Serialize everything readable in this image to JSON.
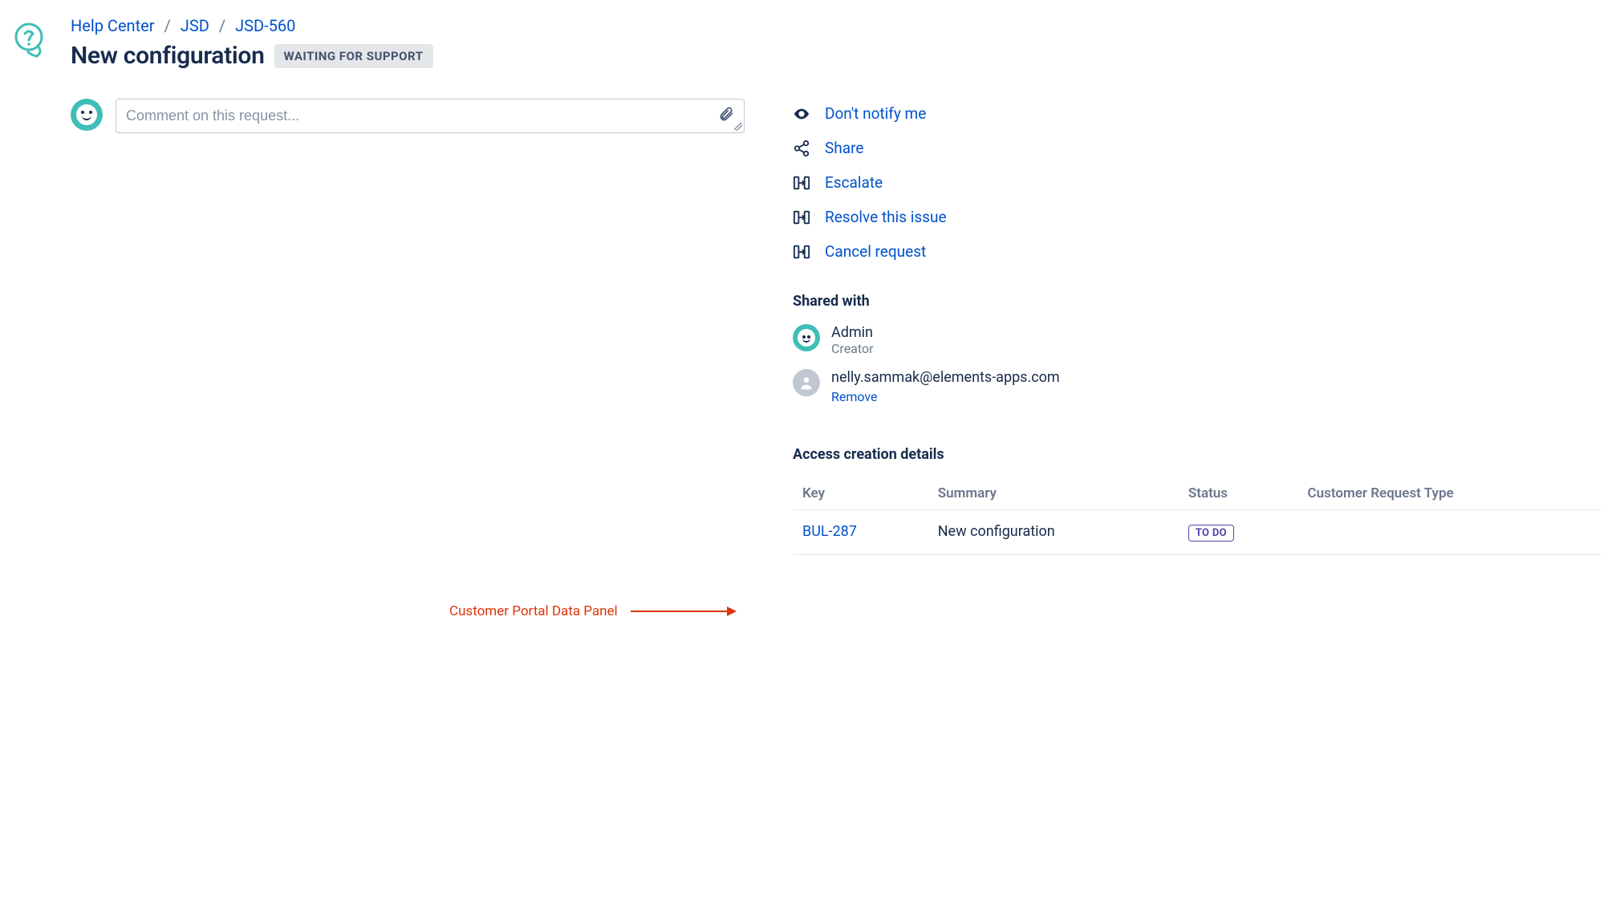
{
  "breadcrumb": {
    "help_center": "Help Center",
    "project": "JSD",
    "issue": "JSD-560"
  },
  "header": {
    "title": "New configuration",
    "status": "WAITING FOR SUPPORT"
  },
  "comment": {
    "placeholder": "Comment on this request..."
  },
  "actions": {
    "notify": "Don't notify me",
    "share": "Share",
    "escalate": "Escalate",
    "resolve": "Resolve this issue",
    "cancel": "Cancel request"
  },
  "shared": {
    "heading": "Shared with",
    "people": [
      {
        "name": "Admin",
        "sub": "Creator",
        "avatar": "admin"
      },
      {
        "name": "nelly.sammak@elements-apps.com",
        "remove_label": "Remove",
        "avatar": "grey"
      }
    ]
  },
  "details": {
    "heading": "Access creation details",
    "columns": {
      "key": "Key",
      "summary": "Summary",
      "status": "Status",
      "crt": "Customer Request Type"
    },
    "rows": [
      {
        "key": "BUL-287",
        "summary": "New configuration",
        "status": "TO DO",
        "crt": ""
      }
    ]
  },
  "annotation": {
    "label": "Customer Portal Data Panel"
  }
}
